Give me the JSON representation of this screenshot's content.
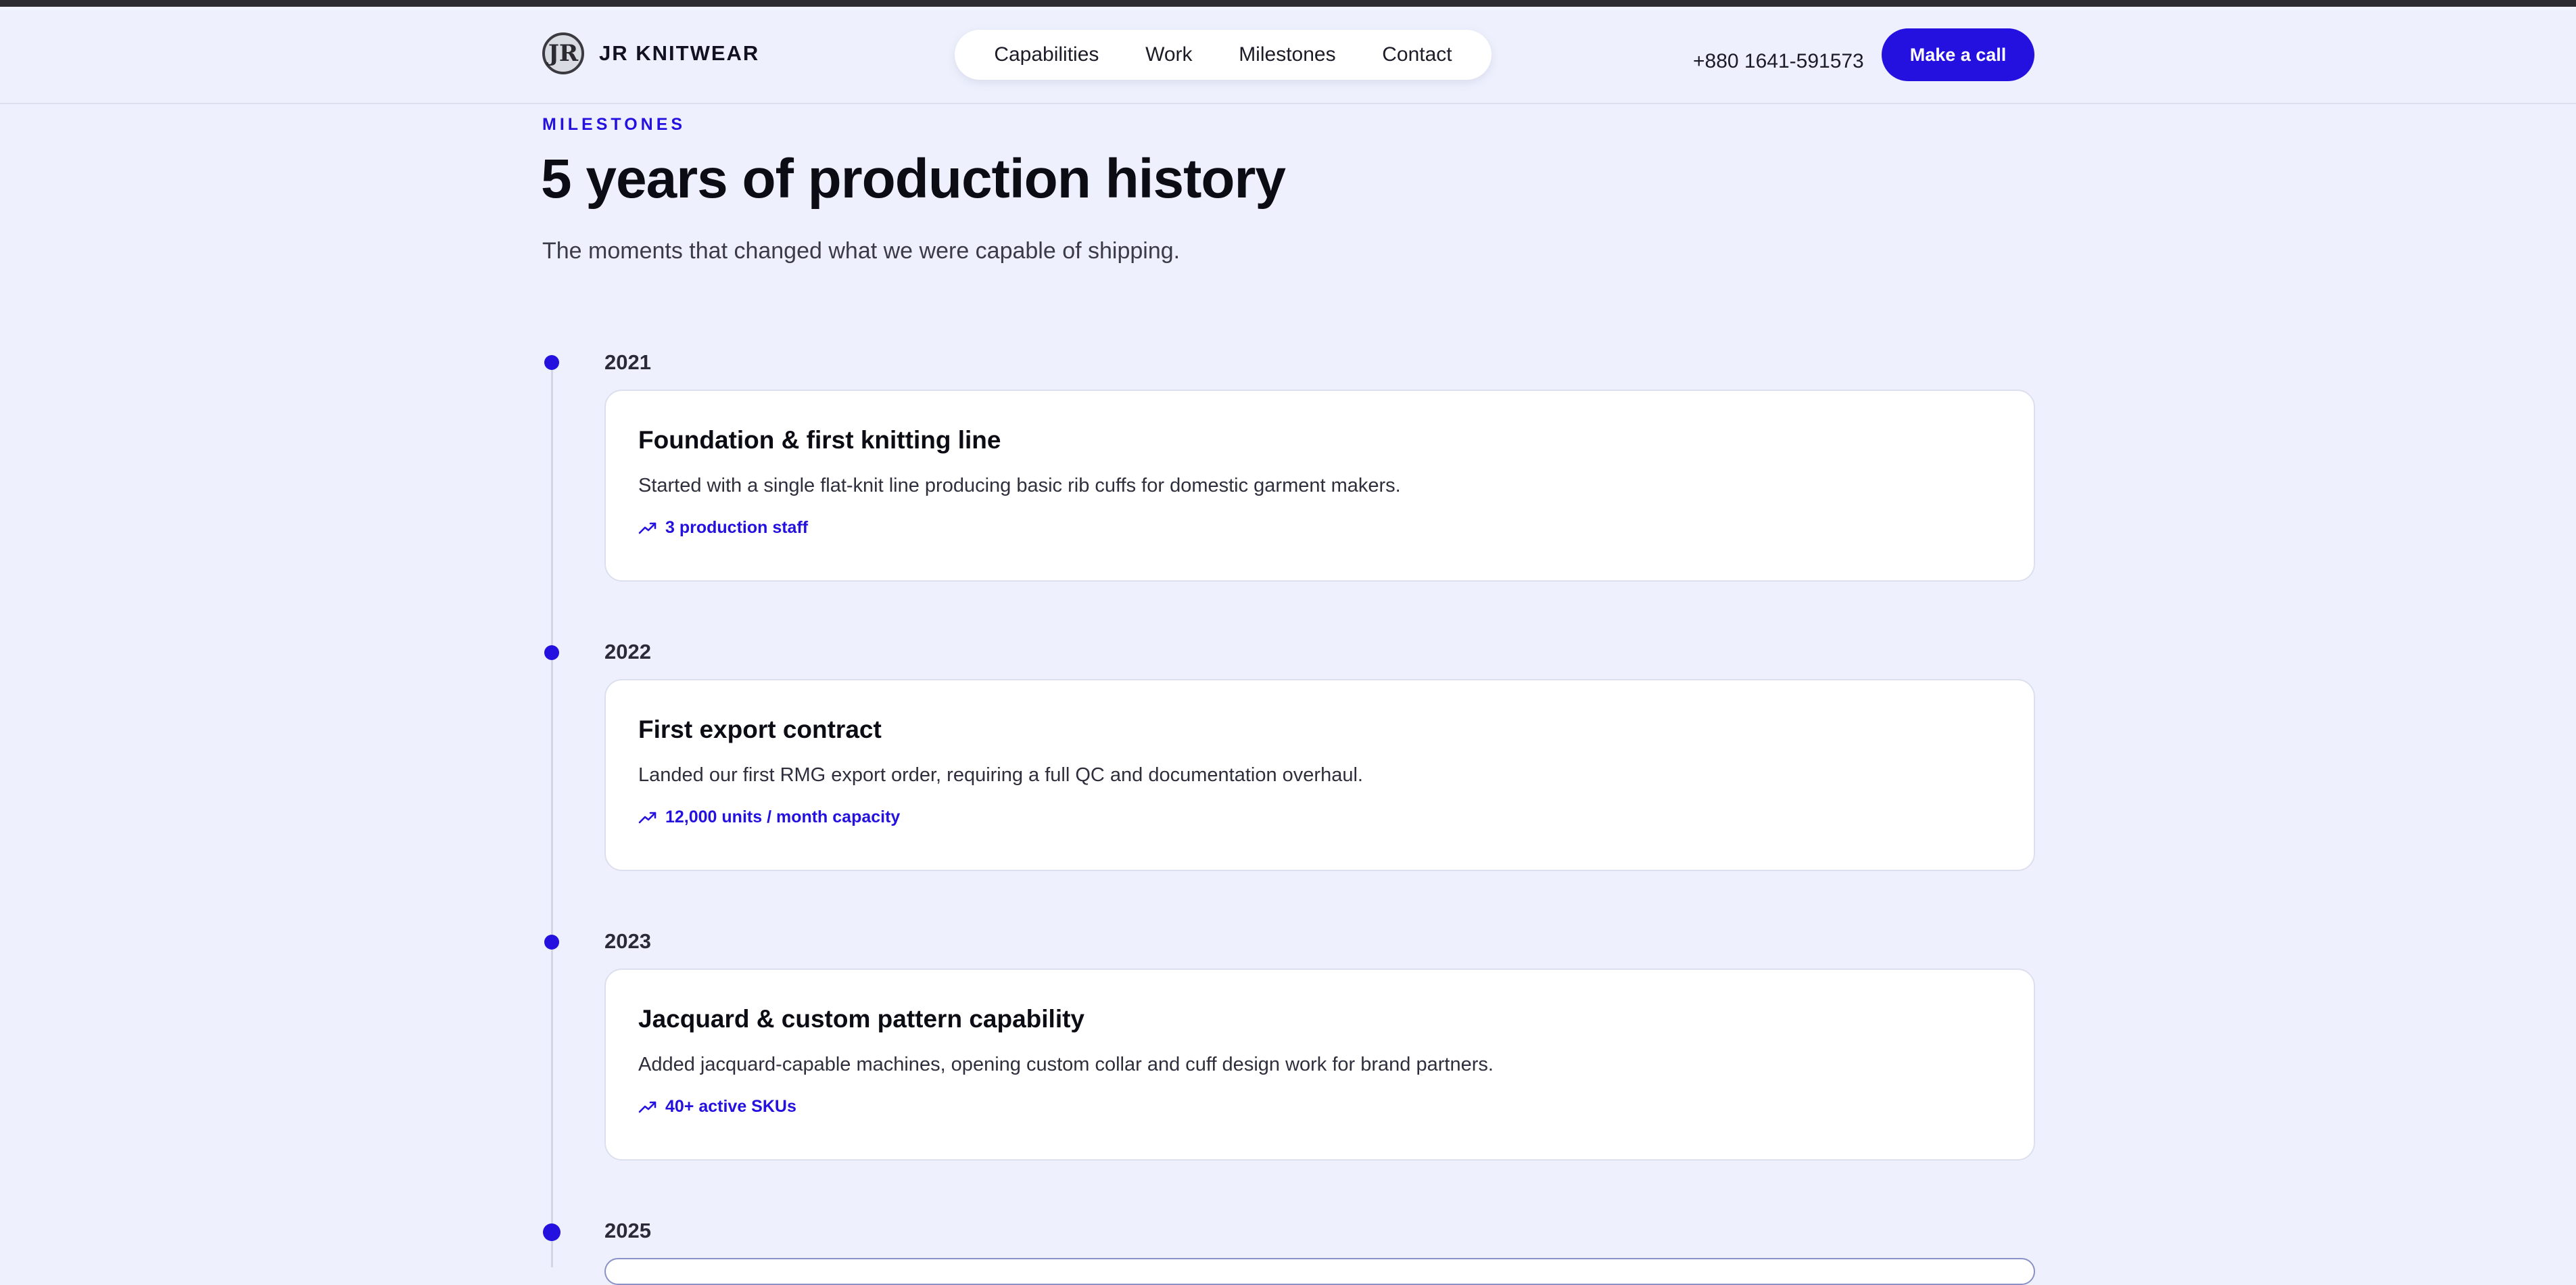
{
  "header": {
    "brand_name": "JR KNITWEAR",
    "logo_mark": "JR",
    "nav": [
      "Capabilities",
      "Work",
      "Milestones",
      "Contact"
    ],
    "phone": "+880 1641-591573",
    "cta_label": "Make a call"
  },
  "section": {
    "eyebrow": "MILESTONES",
    "title": "5 years of production history",
    "subtitle": "The moments that changed what we were capable of shipping."
  },
  "milestones": [
    {
      "year": "2021",
      "title": "Foundation & first knitting line",
      "description": "Started with a single flat-knit line producing basic rib cuffs for domestic garment makers.",
      "stat": "3 production staff"
    },
    {
      "year": "2022",
      "title": "First export contract",
      "description": "Landed our first RMG export order, requiring a full QC and documentation overhaul.",
      "stat": "12,000 units / month capacity"
    },
    {
      "year": "2023",
      "title": "Jacquard & custom pattern capability",
      "description": "Added jacquard-capable machines, opening custom collar and cuff design work for brand partners.",
      "stat": "40+ active SKUs"
    },
    {
      "year": "2025"
    }
  ],
  "colors": {
    "accent": "#2411e0",
    "background": "#eef1fd",
    "card": "#ffffff"
  }
}
